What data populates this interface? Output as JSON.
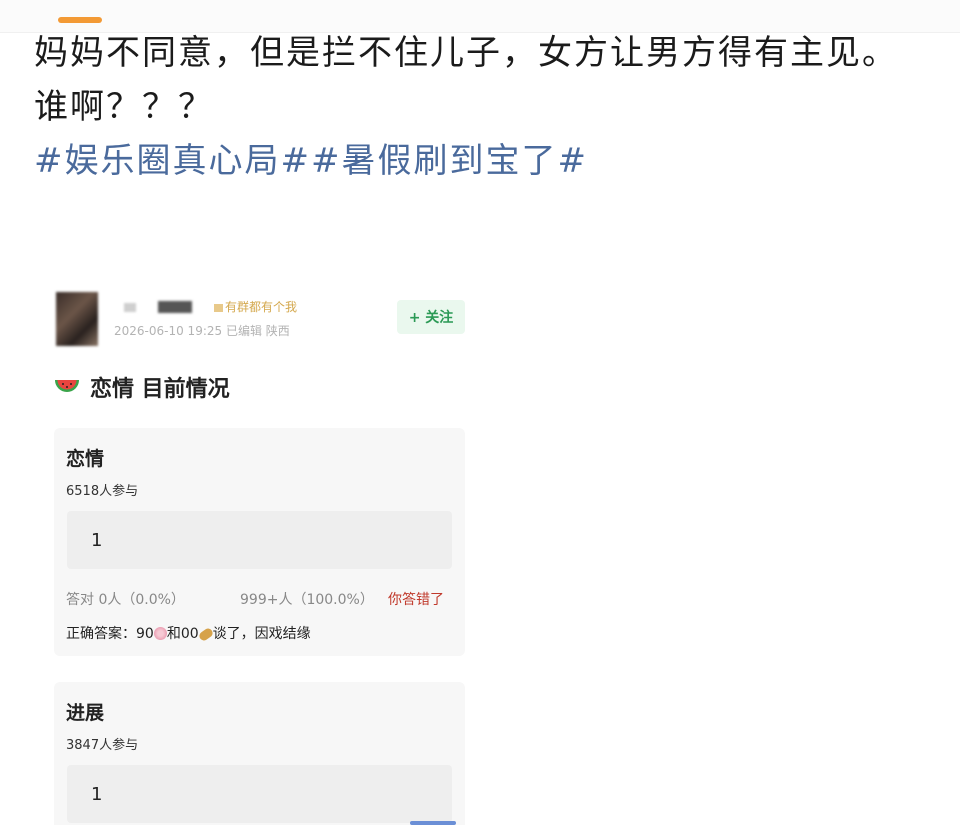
{
  "post": {
    "line1": "妈妈不同意，但是拦不住儿子，女方让男方得有主见。",
    "line2": "谁啊？？？",
    "hashtags": "#娱乐圈真心局##暑假刷到宝了#"
  },
  "embedded": {
    "badge": "有群都有个我",
    "meta": "2026-06-10 19:25  已编辑  陕西",
    "follow_label": "+ 关注",
    "section_title": "恋情 目前情况",
    "cards": [
      {
        "title": "恋情",
        "participants": "6518人参与",
        "answer": "1",
        "stats_left": "答对 0人（0.0%）",
        "stats_mid": "999+人（100.0%）",
        "stats_right": "你答错了",
        "correct_prefix": "正确答案：90",
        "correct_mid": "和00",
        "correct_suffix": "谈了，因戏结缘"
      },
      {
        "title": "进展",
        "participants": "3847人参与",
        "answer": "1"
      }
    ]
  },
  "colors": {
    "hashtag": "#4a6a9c",
    "follow_text": "#2b9a55",
    "wrong": "#c0392b",
    "tab_accent": "#f39a35"
  }
}
